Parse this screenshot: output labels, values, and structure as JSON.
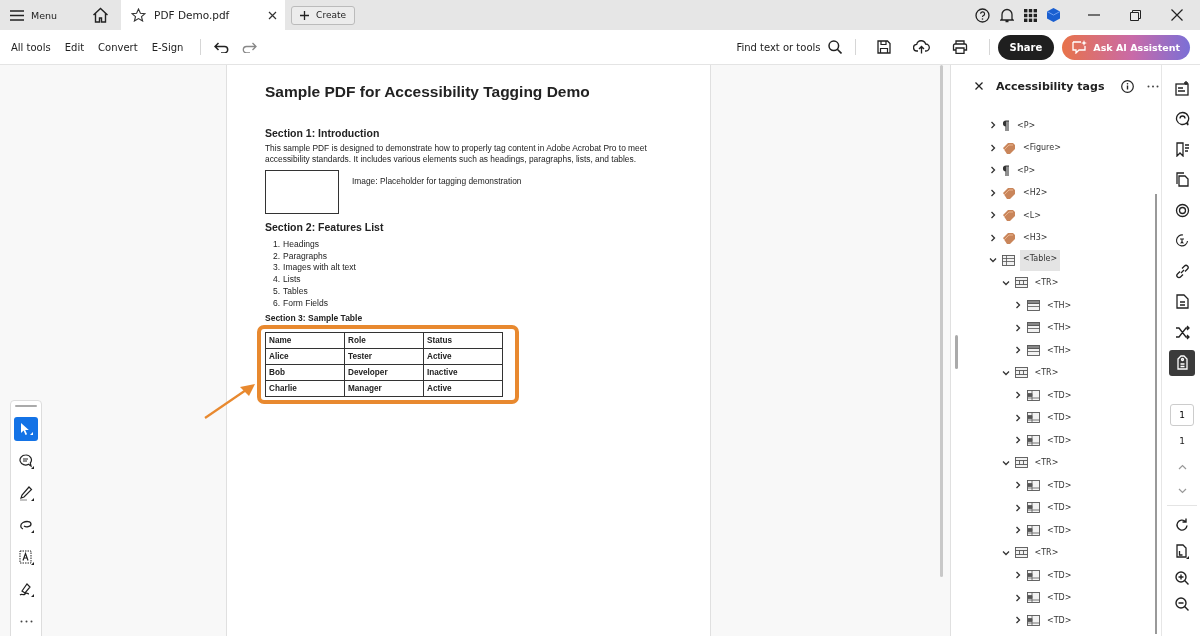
{
  "tab_bar": {
    "menu_label": "Menu",
    "tab": {
      "title": "PDF Demo.pdf",
      "selected": true
    },
    "create_label": "Create"
  },
  "toolbar": {
    "items": [
      "All tools",
      "Edit",
      "Convert",
      "E-Sign"
    ],
    "search_label": "Find text or tools",
    "share_label": "Share",
    "ai_label": "Ask AI Assistent"
  },
  "document": {
    "title": "Sample PDF for Accessibility Tagging Demo",
    "section_1": {
      "heading": "Section 1: Introduction",
      "paragraph": "This sample PDF is designed to demonstrate how to properly tag content in Adobe Acrobat Pro to meet accessibility standards. It includes various elements such as headings, paragraphs, lists, and tables.",
      "image_caption": "Image: Placeholder for tagging demonstration"
    },
    "section_2": {
      "heading": "Section 2: Features List",
      "items": [
        {
          "number": "1.",
          "text": "Headings"
        },
        {
          "number": "2.",
          "text": "Paragraphs"
        },
        {
          "number": "3.",
          "text": "Images with alt text"
        },
        {
          "number": "4.",
          "text": "Lists"
        },
        {
          "number": "5.",
          "text": "Tables"
        },
        {
          "number": "6.",
          "text": "Form Fields"
        }
      ]
    },
    "section_3": {
      "heading": "Section 3: Sample Table",
      "columns": [
        "Name",
        "Role",
        "Status"
      ],
      "rows": [
        [
          "Alice",
          "Tester",
          "Active"
        ],
        [
          "Bob",
          "Developer",
          "Inactive"
        ],
        [
          "Charlie",
          "Manager",
          "Active"
        ]
      ]
    }
  },
  "left_tools": [
    {
      "kind": "select",
      "selected": true
    },
    {
      "kind": "comment",
      "selected": false
    },
    {
      "kind": "draw",
      "selected": false
    },
    {
      "kind": "lasso",
      "selected": false
    },
    {
      "kind": "text",
      "selected": false
    },
    {
      "kind": "sign",
      "selected": false
    },
    {
      "kind": "more",
      "selected": false
    }
  ],
  "tags_panel": {
    "title": "Accessibility tags",
    "tree": [
      {
        "kind": "paragraph",
        "label": "<P>",
        "expanded": false,
        "selected": false
      },
      {
        "kind": "tag",
        "label": "<Figure>",
        "expanded": false,
        "selected": false
      },
      {
        "kind": "paragraph",
        "label": "<P>",
        "expanded": false,
        "selected": false
      },
      {
        "kind": "tag",
        "label": "<H2>",
        "expanded": false,
        "selected": false
      },
      {
        "kind": "tag",
        "label": "<L>",
        "expanded": false,
        "selected": false
      },
      {
        "kind": "tag",
        "label": "<H3>",
        "expanded": false,
        "selected": false
      },
      {
        "kind": "table",
        "label": "<Table>",
        "expanded": true,
        "selected": true,
        "children": [
          {
            "kind": "row",
            "label": "<TR>",
            "expanded": true,
            "selected": false,
            "children": [
              {
                "kind": "header",
                "label": "<TH>",
                "expanded": false,
                "selected": false
              },
              {
                "kind": "header",
                "label": "<TH>",
                "expanded": false,
                "selected": false
              },
              {
                "kind": "header",
                "label": "<TH>",
                "expanded": false,
                "selected": false
              }
            ]
          },
          {
            "kind": "row",
            "label": "<TR>",
            "expanded": true,
            "selected": false,
            "children": [
              {
                "kind": "cell",
                "label": "<TD>",
                "expanded": false,
                "selected": false
              },
              {
                "kind": "cell",
                "label": "<TD>",
                "expanded": false,
                "selected": false
              },
              {
                "kind": "cell",
                "label": "<TD>",
                "expanded": false,
                "selected": false
              }
            ]
          },
          {
            "kind": "row",
            "label": "<TR>",
            "expanded": true,
            "selected": false,
            "children": [
              {
                "kind": "cell",
                "label": "<TD>",
                "expanded": false,
                "selected": false
              },
              {
                "kind": "cell",
                "label": "<TD>",
                "expanded": false,
                "selected": false
              },
              {
                "kind": "cell",
                "label": "<TD>",
                "expanded": false,
                "selected": false
              }
            ]
          },
          {
            "kind": "row",
            "label": "<TR>",
            "expanded": true,
            "selected": false,
            "children": [
              {
                "kind": "cell",
                "label": "<TD>",
                "expanded": false,
                "selected": false
              },
              {
                "kind": "cell",
                "label": "<TD>",
                "expanded": false,
                "selected": false
              },
              {
                "kind": "cell",
                "label": "<TD>",
                "expanded": false,
                "selected": false
              }
            ]
          }
        ]
      }
    ]
  },
  "right_rail": {
    "tools": [
      {
        "kind": "edit",
        "selected": false
      },
      {
        "kind": "comment",
        "selected": false
      },
      {
        "kind": "bookmark",
        "selected": false
      },
      {
        "kind": "pages",
        "selected": false
      },
      {
        "kind": "target",
        "selected": false
      },
      {
        "kind": "accessibility",
        "selected": false
      },
      {
        "kind": "link",
        "selected": false
      },
      {
        "kind": "document",
        "selected": false
      },
      {
        "kind": "compare",
        "selected": false
      },
      {
        "kind": "tags",
        "selected": true
      }
    ],
    "page_field": {
      "value": "1"
    },
    "page_count": "1"
  }
}
